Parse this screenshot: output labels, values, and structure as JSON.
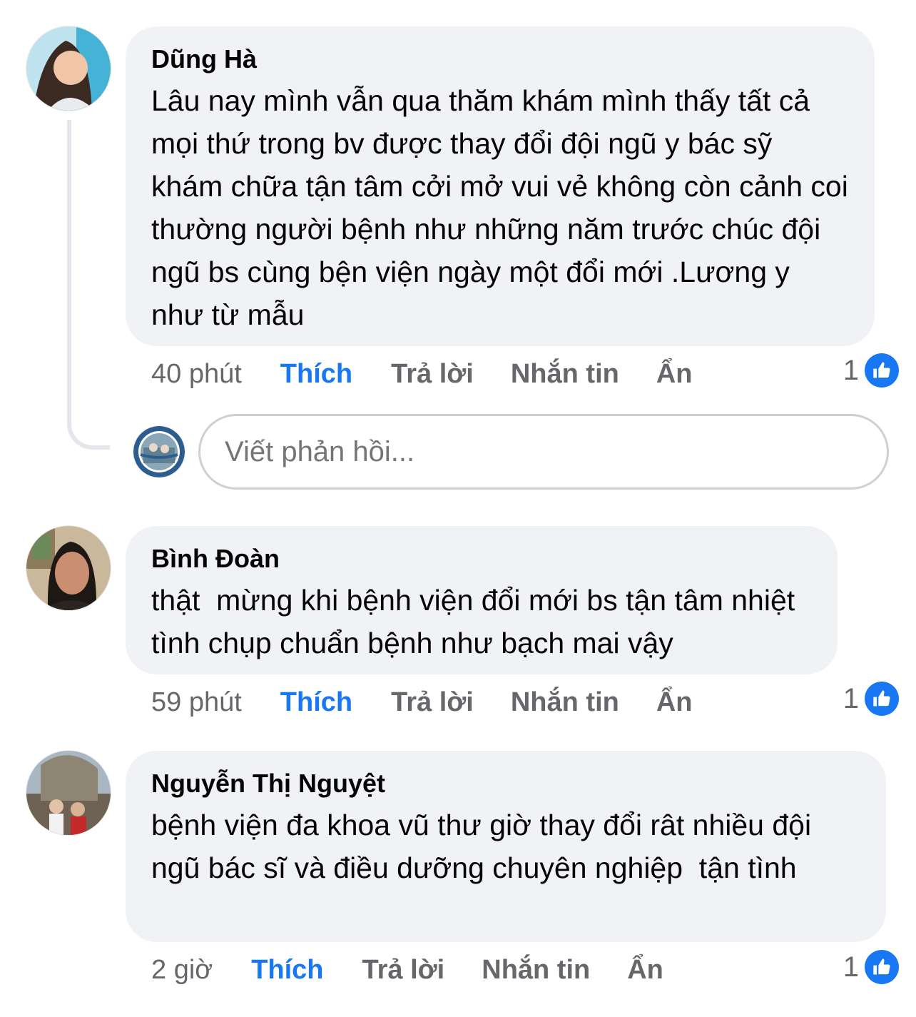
{
  "comments": [
    {
      "author": "Dũng Hà",
      "text": "Lâu nay mình vẫn qua thăm khám mình thấy tất cả mọi thứ trong bv được thay đổi đội ngũ y bác sỹ khám chữa tận tâm cởi mở vui vẻ không còn cảnh coi thường người bệnh như những năm trước chúc đội ngũ bs cùng bện viện ngày một đổi mới .Lương y như từ mẫu",
      "time": "40 phút",
      "reactions": "1"
    },
    {
      "author": "Bình Đoàn",
      "text": "thật  mừng khi bệnh viện đổi mới bs tận tâm nhiệt tình chụp chuẩn bệnh như bạch mai vậy",
      "time": "59 phút",
      "reactions": "1"
    },
    {
      "author": "Nguyễn Thị Nguyệt",
      "text": "bệnh viện đa khoa vũ thư giờ thay đổi rât nhiều đội ngũ bác sĩ và điều dưỡng chuyên nghiệp  tận tình",
      "time": "2 giờ",
      "reactions": "1"
    }
  ],
  "actions": {
    "like": "Thích",
    "reply": "Trả lời",
    "message": "Nhắn tin",
    "hide": "Ẩn"
  },
  "reply_box": {
    "placeholder": "Viết phản hồi..."
  },
  "colors": {
    "like_blue": "#1877f2",
    "bubble_bg": "#f0f2f5",
    "meta_gray": "#65676b"
  }
}
